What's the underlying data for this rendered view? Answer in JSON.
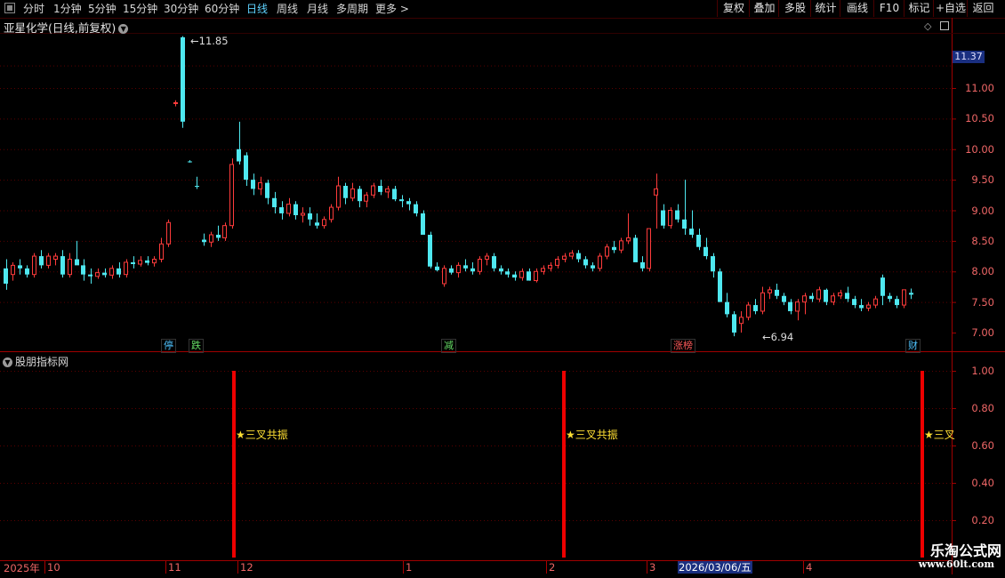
{
  "toolbar": {
    "periods": [
      "分时",
      "1分钟",
      "5分钟",
      "15分钟",
      "30分钟",
      "60分钟",
      "日线",
      "周线",
      "月线",
      "多周期",
      "更多"
    ],
    "active_period": "日线",
    "more_arrow": ">",
    "right_buttons": [
      "复权",
      "叠加",
      "多股",
      "统计",
      "画线",
      "F10",
      "标记",
      "+自选",
      "返回"
    ]
  },
  "chart": {
    "title": "亚星化学(日线,前复权)",
    "current_price": "11.37",
    "high_label": "11.85",
    "low_label": "6.94",
    "y_ticks": [
      "11.00",
      "10.50",
      "10.00",
      "9.50",
      "9.00",
      "8.50",
      "8.00",
      "7.50",
      "7.00"
    ],
    "markers": [
      {
        "text": "停",
        "color": "#4fc3ff"
      },
      {
        "text": "跌",
        "color": "#66dd66"
      },
      {
        "text": "减",
        "color": "#66dd66"
      },
      {
        "text": "涨榜",
        "color": "#ff5a5a"
      },
      {
        "text": "财",
        "color": "#4fc3ff"
      }
    ]
  },
  "indicator": {
    "title": "股朋指标网",
    "y_ticks": [
      "1.00",
      "0.80",
      "0.60",
      "0.40",
      "0.20"
    ],
    "signal_text": "★三叉共振",
    "signal_text_clipped": "★三叉",
    "signal_value": 1.0
  },
  "date_axis": {
    "labels": [
      "2025年",
      "10",
      "11",
      "12",
      "1",
      "2",
      "3",
      "4"
    ],
    "cursor_date": "2026/03/06/五"
  },
  "watermark": {
    "line1": "乐淘公式网",
    "line2": "www.60lt.com"
  },
  "colors": {
    "up": "#ff3b3b",
    "down": "#4fe8f0",
    "grid": "#5a0000",
    "signal_bar": "#ee0000",
    "signal_text": "#ffe033",
    "axis_text": "#e66666"
  },
  "chart_data": {
    "type": "candlestick",
    "ylim": [
      6.8,
      11.9
    ],
    "candles": [
      [
        8.05,
        8.2,
        7.7,
        7.8
      ],
      [
        7.95,
        8.15,
        7.85,
        8.1
      ],
      [
        8.1,
        8.2,
        7.95,
        8.05
      ],
      [
        8.05,
        8.1,
        7.9,
        7.95
      ],
      [
        7.95,
        8.3,
        7.9,
        8.25
      ],
      [
        8.25,
        8.35,
        8.05,
        8.1
      ],
      [
        8.1,
        8.3,
        8.05,
        8.25
      ],
      [
        8.2,
        8.3,
        8.1,
        8.25
      ],
      [
        8.25,
        8.35,
        7.9,
        7.95
      ],
      [
        7.95,
        8.3,
        7.9,
        8.2
      ],
      [
        8.2,
        8.5,
        8.15,
        8.1
      ],
      [
        8.1,
        8.2,
        7.85,
        7.95
      ],
      [
        7.95,
        8.05,
        7.8,
        7.92
      ],
      [
        7.92,
        8.05,
        7.88,
        7.98
      ],
      [
        7.98,
        8.05,
        7.9,
        7.94
      ],
      [
        7.94,
        8.1,
        7.88,
        8.05
      ],
      [
        8.05,
        8.15,
        7.9,
        7.95
      ],
      [
        7.95,
        8.2,
        7.9,
        8.15
      ],
      [
        8.15,
        8.25,
        8.05,
        8.12
      ],
      [
        8.12,
        8.25,
        8.08,
        8.18
      ],
      [
        8.18,
        8.25,
        8.1,
        8.14
      ],
      [
        8.14,
        8.25,
        8.08,
        8.2
      ],
      [
        8.2,
        8.55,
        8.15,
        8.45
      ],
      [
        8.45,
        8.85,
        8.4,
        8.8
      ],
      [
        10.75,
        10.8,
        10.7,
        10.76
      ],
      [
        11.83,
        11.85,
        10.35,
        10.45
      ],
      [
        9.8,
        9.82,
        9.78,
        9.8
      ],
      [
        9.4,
        9.55,
        9.35,
        9.4
      ],
      [
        8.52,
        8.62,
        8.42,
        8.48
      ],
      [
        8.48,
        8.65,
        8.4,
        8.6
      ],
      [
        8.6,
        8.75,
        8.5,
        8.55
      ],
      [
        8.55,
        8.8,
        8.5,
        8.75
      ],
      [
        8.75,
        9.85,
        8.7,
        9.75
      ],
      [
        10.0,
        10.45,
        9.75,
        9.8
      ],
      [
        9.9,
        9.95,
        9.4,
        9.5
      ],
      [
        9.5,
        9.6,
        9.25,
        9.35
      ],
      [
        9.35,
        9.55,
        9.25,
        9.45
      ],
      [
        9.45,
        9.5,
        9.1,
        9.2
      ],
      [
        9.2,
        9.3,
        8.95,
        9.05
      ],
      [
        9.05,
        9.15,
        8.85,
        8.95
      ],
      [
        8.95,
        9.2,
        8.9,
        9.1
      ],
      [
        9.1,
        9.15,
        8.85,
        8.92
      ],
      [
        8.92,
        9.05,
        8.8,
        8.95
      ],
      [
        8.95,
        9.05,
        8.75,
        8.85
      ],
      [
        8.8,
        8.95,
        8.7,
        8.75
      ],
      [
        8.75,
        8.9,
        8.7,
        8.85
      ],
      [
        8.85,
        9.1,
        8.8,
        9.05
      ],
      [
        9.05,
        9.55,
        9.0,
        9.4
      ],
      [
        9.4,
        9.45,
        9.1,
        9.2
      ],
      [
        9.2,
        9.45,
        9.15,
        9.35
      ],
      [
        9.35,
        9.4,
        9.05,
        9.15
      ],
      [
        9.15,
        9.3,
        9.05,
        9.25
      ],
      [
        9.25,
        9.45,
        9.2,
        9.4
      ],
      [
        9.4,
        9.5,
        9.25,
        9.3
      ],
      [
        9.3,
        9.4,
        9.2,
        9.35
      ],
      [
        9.35,
        9.4,
        9.15,
        9.18
      ],
      [
        9.18,
        9.25,
        9.05,
        9.15
      ],
      [
        9.15,
        9.2,
        9.0,
        9.1
      ],
      [
        9.1,
        9.15,
        8.9,
        8.95
      ],
      [
        8.95,
        9.0,
        8.6,
        8.6
      ],
      [
        8.6,
        8.65,
        8.05,
        8.08
      ],
      [
        8.08,
        8.15,
        8.0,
        8.02
      ],
      [
        7.8,
        8.1,
        7.75,
        8.05
      ],
      [
        8.05,
        8.1,
        7.95,
        7.98
      ],
      [
        7.98,
        8.15,
        7.9,
        8.1
      ],
      [
        8.1,
        8.2,
        8.0,
        8.05
      ],
      [
        8.05,
        8.15,
        7.95,
        8.0
      ],
      [
        8.0,
        8.25,
        7.95,
        8.2
      ],
      [
        8.2,
        8.3,
        8.1,
        8.25
      ],
      [
        8.25,
        8.3,
        8.0,
        8.05
      ],
      [
        8.05,
        8.1,
        7.95,
        8.0
      ],
      [
        8.0,
        8.05,
        7.9,
        7.95
      ],
      [
        7.95,
        8.0,
        7.85,
        7.9
      ],
      [
        7.9,
        8.05,
        7.85,
        8.0
      ],
      [
        8.0,
        8.05,
        7.85,
        7.85
      ],
      [
        7.85,
        8.05,
        7.82,
        8.0
      ],
      [
        8.0,
        8.1,
        7.95,
        8.05
      ],
      [
        8.05,
        8.15,
        8.0,
        8.1
      ],
      [
        8.1,
        8.25,
        8.05,
        8.2
      ],
      [
        8.2,
        8.3,
        8.15,
        8.25
      ],
      [
        8.25,
        8.35,
        8.2,
        8.3
      ],
      [
        8.3,
        8.35,
        8.15,
        8.2
      ],
      [
        8.2,
        8.25,
        8.05,
        8.1
      ],
      [
        8.1,
        8.15,
        8.0,
        8.05
      ],
      [
        8.05,
        8.3,
        8.0,
        8.25
      ],
      [
        8.25,
        8.45,
        8.2,
        8.4
      ],
      [
        8.4,
        8.5,
        8.3,
        8.35
      ],
      [
        8.35,
        8.55,
        8.3,
        8.5
      ],
      [
        8.5,
        8.95,
        8.45,
        8.55
      ],
      [
        8.55,
        8.6,
        8.25,
        8.15
      ],
      [
        8.15,
        8.25,
        8.0,
        8.05
      ],
      [
        8.05,
        8.7,
        8.0,
        8.7
      ],
      [
        9.25,
        9.6,
        8.7,
        9.35
      ],
      [
        9.0,
        9.1,
        8.7,
        8.75
      ],
      [
        8.75,
        9.05,
        8.7,
        9.0
      ],
      [
        9.0,
        9.1,
        8.8,
        8.85
      ],
      [
        8.85,
        9.5,
        8.6,
        8.7
      ],
      [
        8.7,
        9.0,
        8.55,
        8.6
      ],
      [
        8.6,
        8.7,
        8.35,
        8.4
      ],
      [
        8.4,
        8.55,
        8.2,
        8.25
      ],
      [
        8.25,
        8.3,
        7.9,
        8.0
      ],
      [
        8.0,
        8.05,
        7.5,
        7.5
      ],
      [
        7.5,
        7.65,
        7.25,
        7.3
      ],
      [
        7.3,
        7.35,
        6.94,
        7.0
      ],
      [
        7.15,
        7.35,
        7.0,
        7.25
      ],
      [
        7.25,
        7.5,
        7.2,
        7.45
      ],
      [
        7.45,
        7.55,
        7.3,
        7.35
      ],
      [
        7.35,
        7.75,
        7.3,
        7.65
      ],
      [
        7.65,
        7.75,
        7.55,
        7.7
      ],
      [
        7.7,
        7.8,
        7.55,
        7.6
      ],
      [
        7.6,
        7.65,
        7.45,
        7.5
      ],
      [
        7.5,
        7.55,
        7.3,
        7.35
      ],
      [
        7.35,
        7.55,
        7.2,
        7.5
      ],
      [
        7.5,
        7.65,
        7.3,
        7.6
      ],
      [
        7.6,
        7.65,
        7.5,
        7.55
      ],
      [
        7.55,
        7.75,
        7.5,
        7.7
      ],
      [
        7.7,
        7.72,
        7.45,
        7.5
      ],
      [
        7.5,
        7.65,
        7.45,
        7.6
      ],
      [
        7.6,
        7.7,
        7.55,
        7.65
      ],
      [
        7.65,
        7.75,
        7.5,
        7.55
      ],
      [
        7.55,
        7.6,
        7.4,
        7.45
      ],
      [
        7.45,
        7.55,
        7.35,
        7.4
      ],
      [
        7.4,
        7.5,
        7.35,
        7.45
      ],
      [
        7.45,
        7.6,
        7.4,
        7.55
      ],
      [
        7.9,
        7.95,
        7.45,
        7.6
      ],
      [
        7.6,
        7.65,
        7.5,
        7.55
      ],
      [
        7.55,
        7.6,
        7.4,
        7.45
      ],
      [
        7.45,
        7.7,
        7.4,
        7.7
      ],
      [
        7.65,
        7.72,
        7.55,
        7.62
      ]
    ]
  }
}
